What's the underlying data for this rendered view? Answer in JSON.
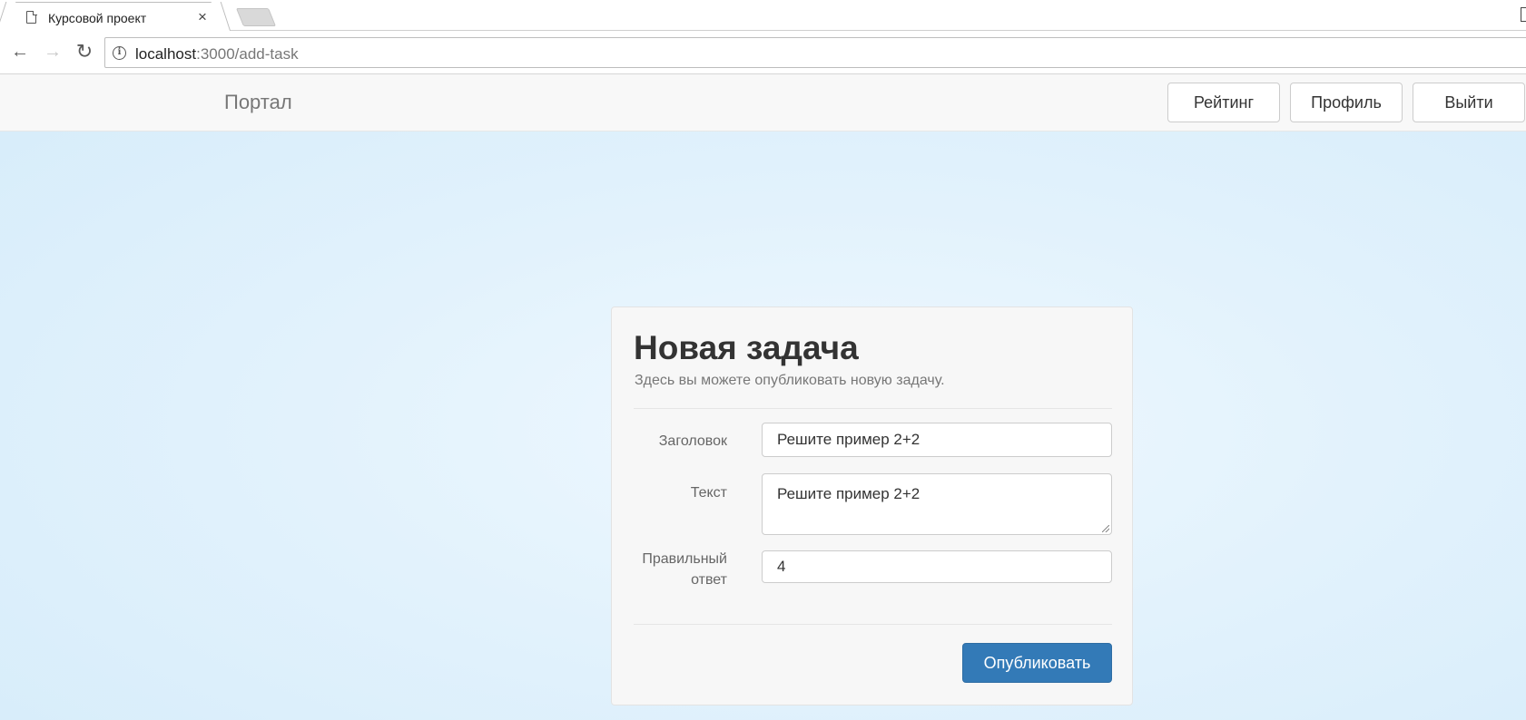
{
  "browser": {
    "tab_title": "Курсовой проект",
    "tab_close": "×",
    "url_host": "localhost",
    "url_path": ":3000/add-task",
    "nav_back": "←",
    "nav_forward": "→",
    "nav_reload": "↻",
    "info": "i"
  },
  "navbar": {
    "brand": "Портал",
    "buttons": [
      "Рейтинг",
      "Профиль",
      "Выйти"
    ]
  },
  "card": {
    "title": "Новая задача",
    "subtitle": "Здесь вы можете опубликовать новую задачу.",
    "fields": {
      "title_label": "Заголовок",
      "title_value": "Решите пример 2+2",
      "text_label": "Текст",
      "text_value": "Решите пример 2+2",
      "answer_label_line1": "Правильный",
      "answer_label_line2": "ответ",
      "answer_value": "4"
    },
    "submit_label": "Опубликовать"
  },
  "colors": {
    "primary": "#337ab7",
    "page_bg": "#e2f2fc",
    "navbar_bg": "#f8f8f8"
  }
}
